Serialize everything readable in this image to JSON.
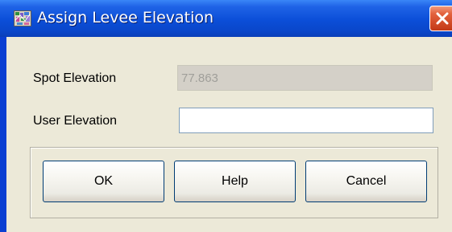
{
  "window": {
    "title": "Assign Levee Elevation",
    "close_icon": "close-icon",
    "app_icon": "map-app-icon"
  },
  "fields": {
    "spot_elevation": {
      "label": "Spot Elevation",
      "value": "77.863",
      "disabled": true
    },
    "user_elevation": {
      "label": "User Elevation",
      "value": "",
      "disabled": false
    }
  },
  "buttons": {
    "ok_label": "OK",
    "help_label": "Help",
    "cancel_label": "Cancel"
  },
  "colors": {
    "titlebar": "#0b4ed8",
    "dialog_bg": "#ece9d8",
    "close_button": "#d14a26",
    "disabled_input_bg": "#d4d0c8",
    "disabled_input_text": "#a09f9a"
  }
}
